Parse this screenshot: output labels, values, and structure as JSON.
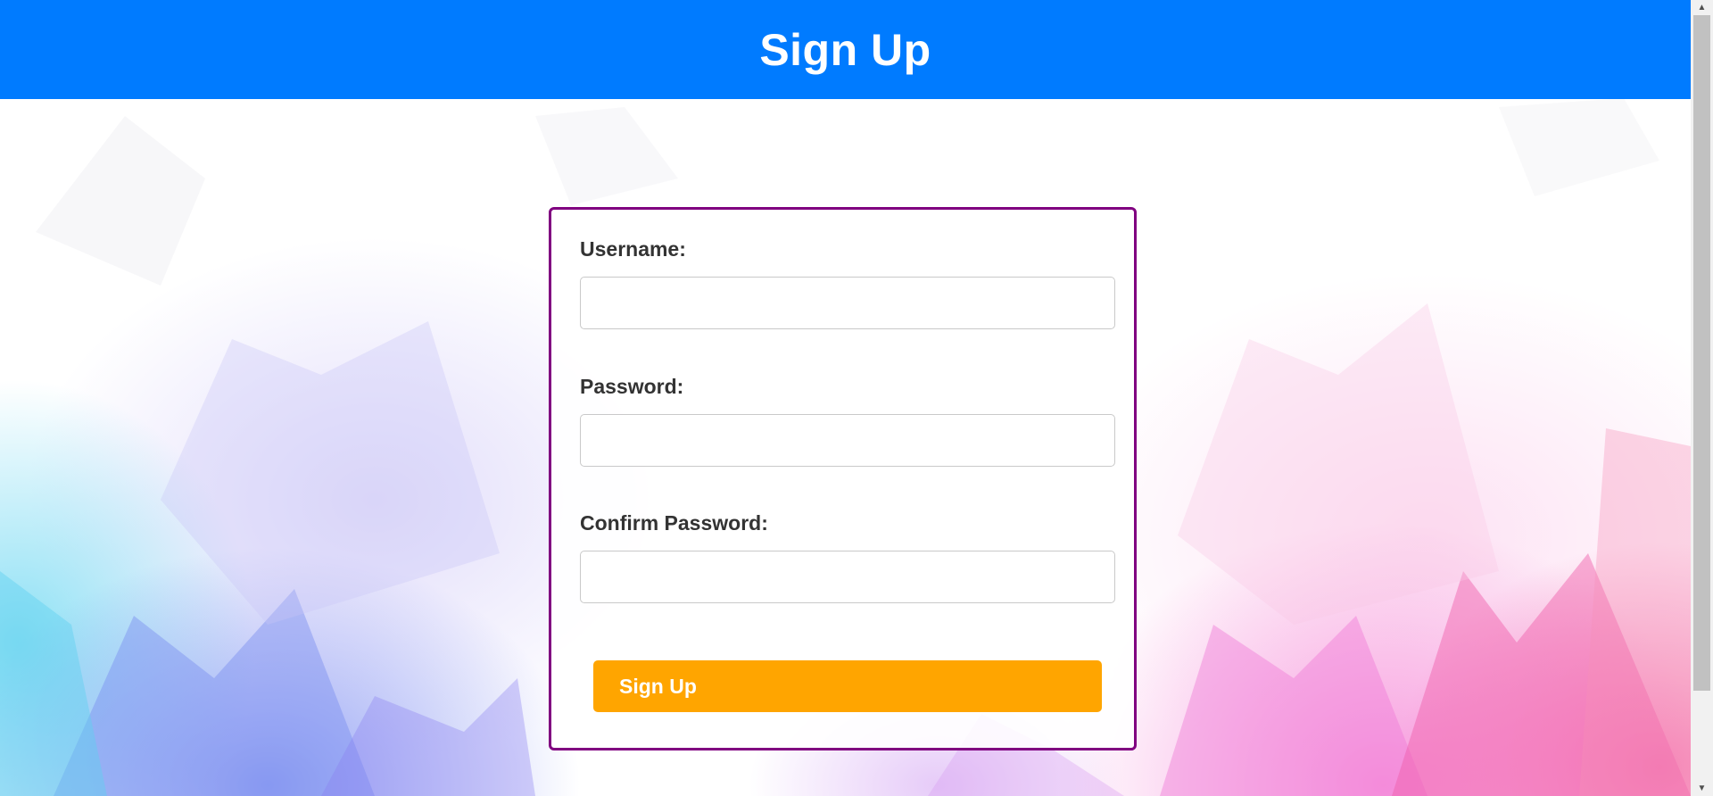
{
  "header": {
    "title": "Sign Up",
    "background_color": "#007bff"
  },
  "form": {
    "border_color": "#800080",
    "fields": [
      {
        "label": "Username:",
        "value": "",
        "type": "text"
      },
      {
        "label": "Password:",
        "value": "",
        "type": "password"
      },
      {
        "label": "Confirm Password:",
        "value": "",
        "type": "password"
      }
    ],
    "submit": {
      "label": "Sign Up",
      "color": "#ffa500"
    }
  },
  "scrollbar": {
    "up_icon": "scroll-up-arrow-icon",
    "down_icon": "scroll-down-arrow-icon"
  }
}
